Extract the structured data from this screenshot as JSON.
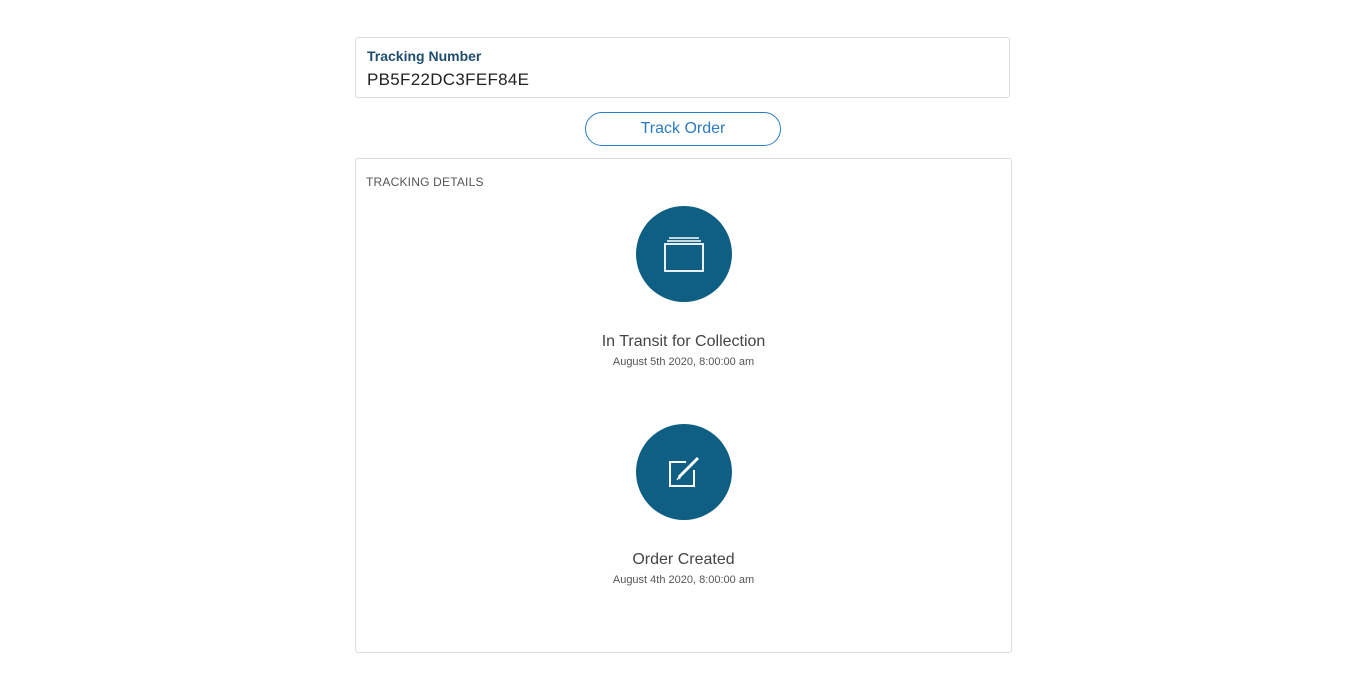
{
  "tracking": {
    "label": "Tracking Number",
    "value": "PB5F22DC3FEF84E"
  },
  "track_button": {
    "label": "Track Order"
  },
  "details": {
    "title": "TRACKING DETAILS",
    "events": [
      {
        "icon": "package-box-icon",
        "title": "In Transit for Collection",
        "time": "August 5th 2020, 8:00:00 am"
      },
      {
        "icon": "edit-icon",
        "title": "Order Created",
        "time": "August 4th 2020, 8:00:00 am"
      }
    ]
  },
  "colors": {
    "accent": "#2c7cc4",
    "icon_circle": "#0f5f84",
    "label": "#1f4e6e"
  }
}
